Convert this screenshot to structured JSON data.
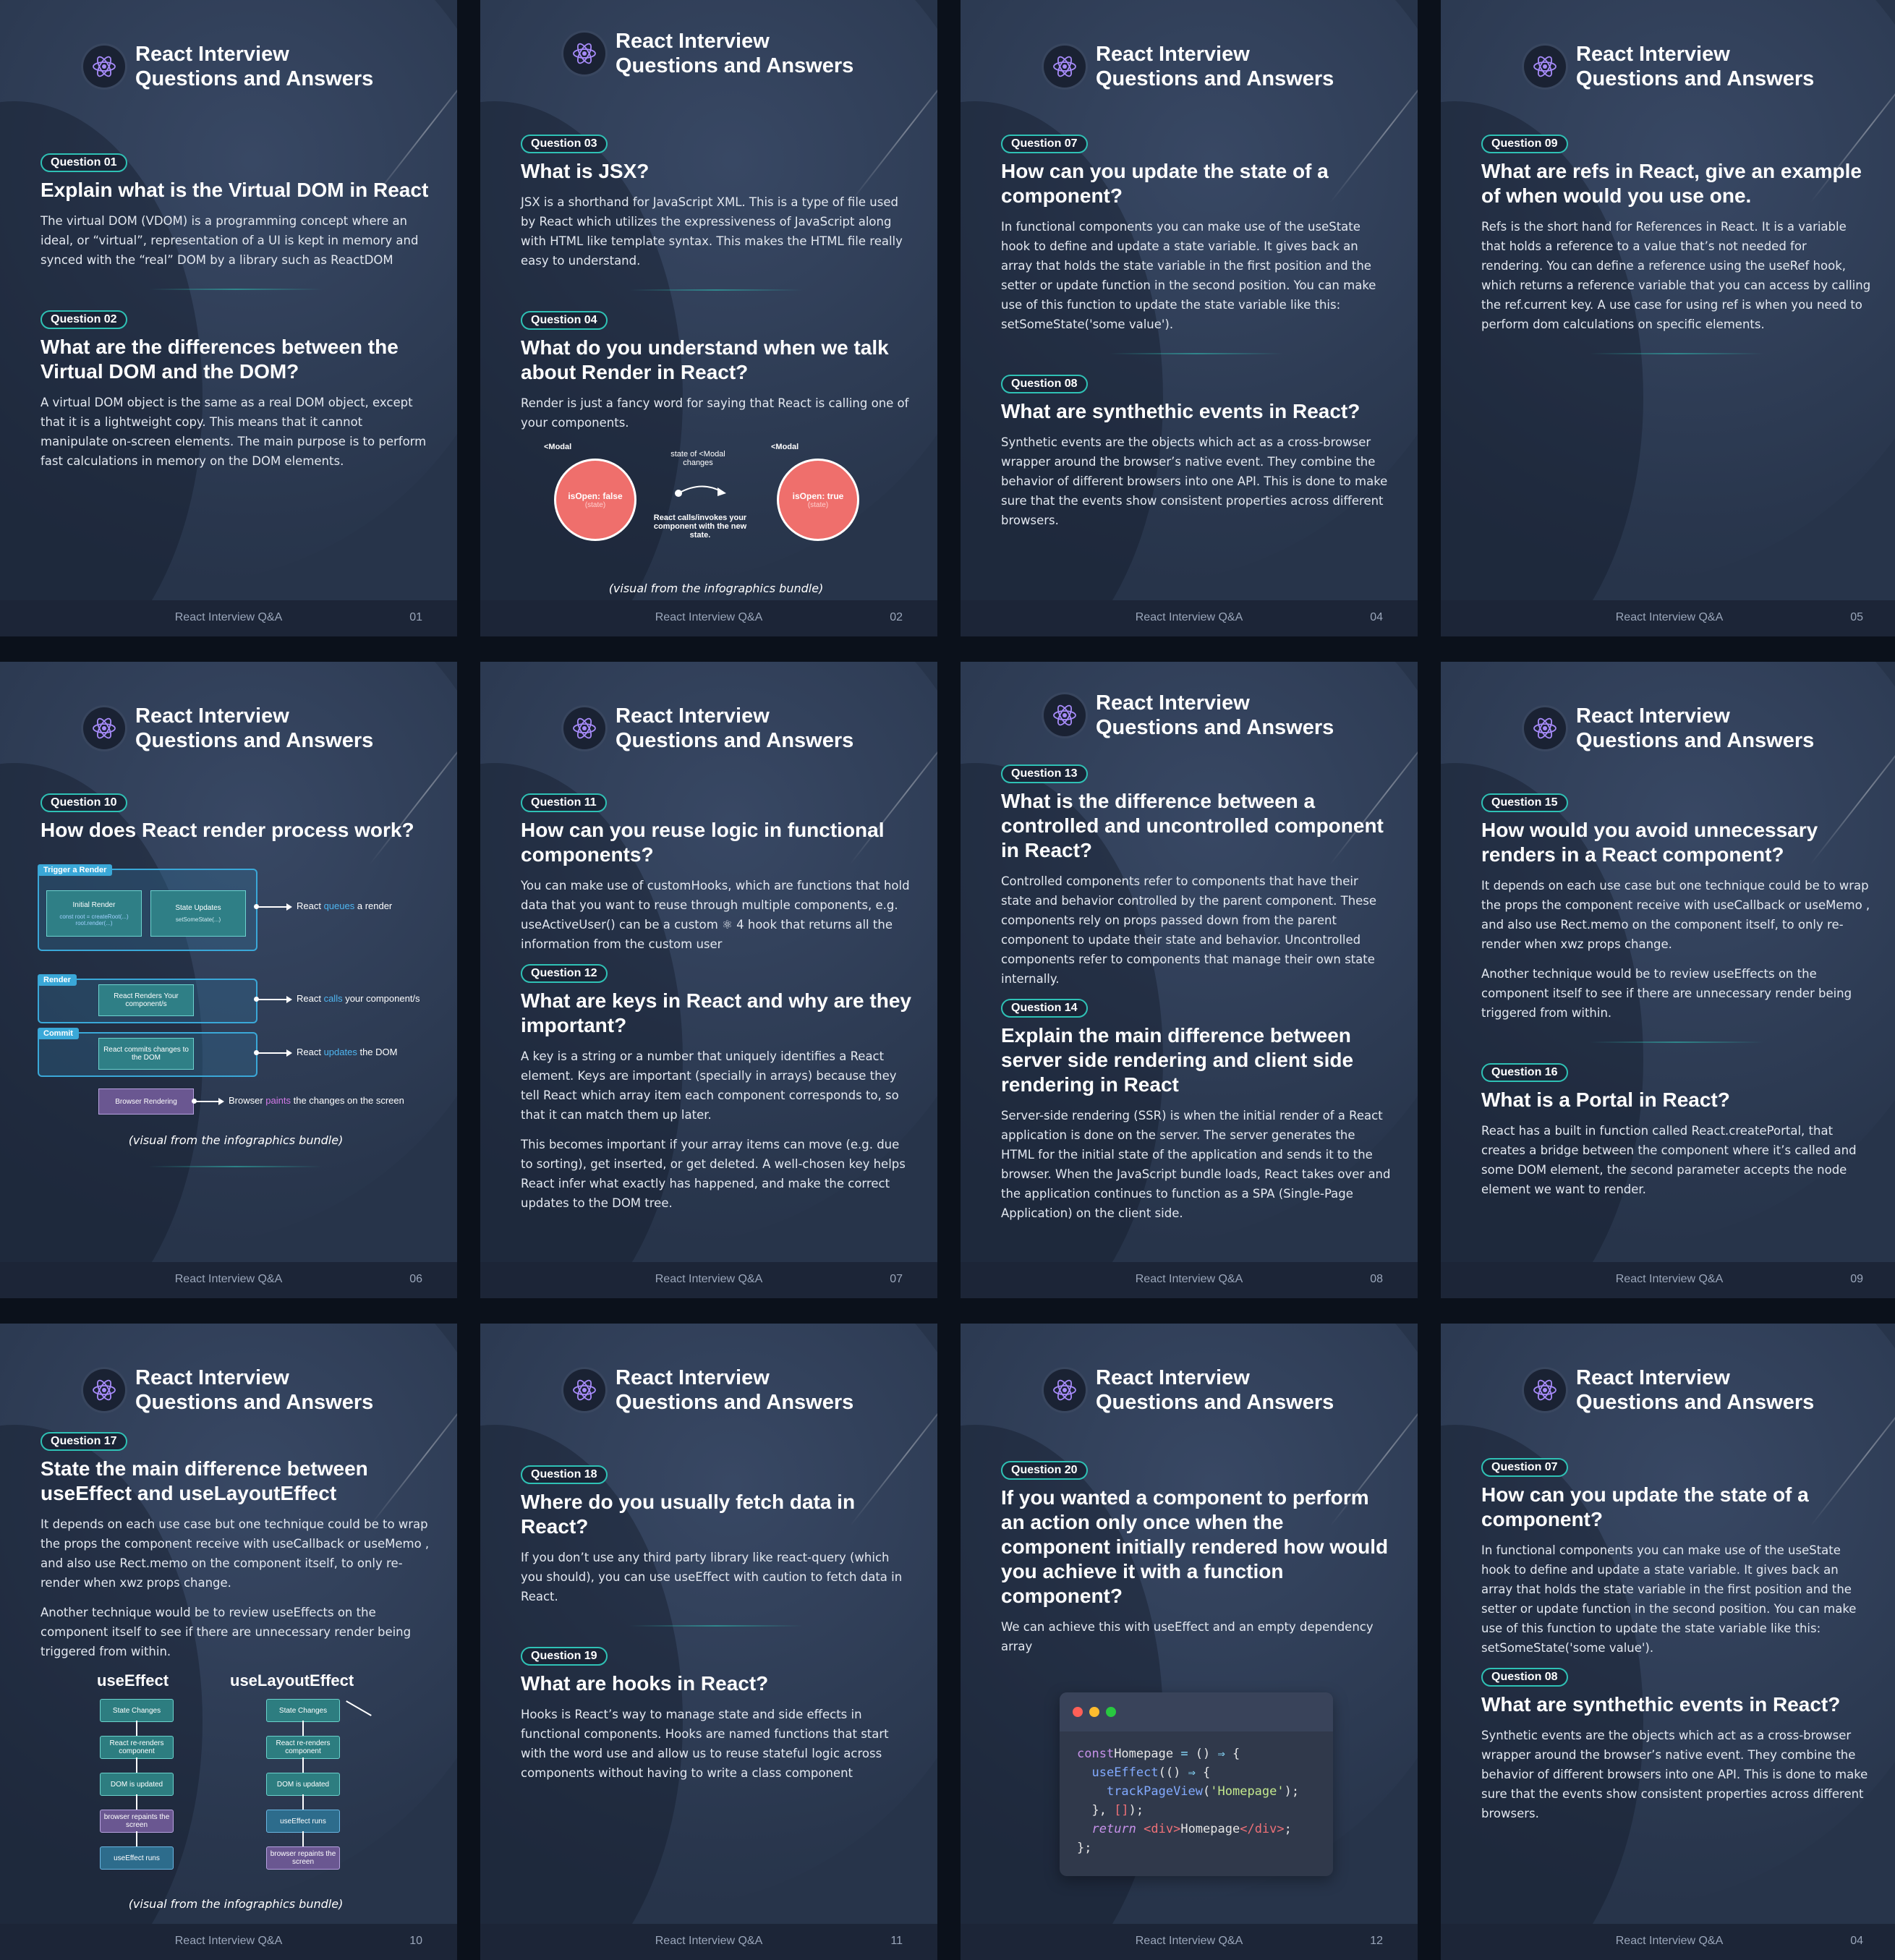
{
  "series_title": [
    "React Interview",
    "Questions and Answers"
  ],
  "footer_label": "React Interview Q&A",
  "caption": "(visual from the infographics bundle)",
  "pages": [
    {
      "number": "01",
      "questions": [
        {
          "badge": "Question 01",
          "title": "Explain what is the Virtual DOM in React",
          "paragraphs": [
            "The virtual DOM (VDOM) is a programming concept where an ideal, or “virtual”, representation of a UI is kept in memory and synced with the “real” DOM by a library such as ReactDOM"
          ]
        },
        {
          "badge": "Question 02",
          "title": "What are the differences between the Virtual DOM and the DOM?",
          "paragraphs": [
            "A virtual DOM object is the same as a real DOM object, except that it is a lightweight copy. This means that it cannot manipulate on-screen elements. The main purpose is to perform fast calculations in memory on the DOM elements."
          ]
        }
      ]
    },
    {
      "number": "02",
      "questions": [
        {
          "badge": "Question 03",
          "title": "What is JSX?",
          "paragraphs": [
            "JSX is a shorthand for JavaScript XML. This is a type of file used by React which utilizes the expressiveness of JavaScript along with HTML like template syntax. This makes the HTML file really easy to understand."
          ]
        },
        {
          "badge": "Question 04",
          "title": "What do you understand when we talk about Render in React?",
          "paragraphs": [
            "Render is just a fancy word for saying that React is calling one of your components."
          ]
        }
      ],
      "render_diagram": {
        "left_tag": "<Modal",
        "right_tag": "<Modal",
        "left_circle": "isOpen: false",
        "right_circle": "isOpen: true",
        "state_sub": "(state)",
        "middle_top": "state of <Modal changes",
        "middle_bottom": "React calls/invokes your component with the new state."
      }
    },
    {
      "number": "04",
      "questions": [
        {
          "badge": "Question 07",
          "title": "How can you update the state of a component?",
          "paragraphs": [
            "In functional components you can make use of the useState hook to define and update a state variable. It gives back an array that holds the state variable in the first position and the setter or update function in the second position. You can make use of this function to update the state variable like this: setSomeState('some value')."
          ]
        },
        {
          "badge": "Question 08",
          "title": "What are synthethic events in React?",
          "paragraphs": [
            "Synthetic events are the objects which act as a cross-browser wrapper around the browser’s native event. They combine the behavior of different browsers into one API. This is done to make sure that the events show consistent properties across different browsers."
          ]
        }
      ]
    },
    {
      "number": "05",
      "questions": [
        {
          "badge": "Question 09",
          "title": "What are refs in React, give an example of when would you use one.",
          "paragraphs": [
            "Refs is the short hand for References in React. It is a variable that holds a reference to a value that’s not needed for rendering. You can define a reference using the useRef hook, which returns a reference variable that you can access by calling the ref.current key. A use case for using ref is when you need to perform dom calculations on specific elements."
          ]
        }
      ]
    },
    {
      "number": "06",
      "questions": [
        {
          "badge": "Question 10",
          "title": "How does React render process work?",
          "paragraphs": []
        }
      ],
      "flow": {
        "trigger": "Trigger a Render",
        "initial": "Initial Render",
        "initial_code": "const root = createRoot(...)\nroot.render(...)",
        "updates": "State Updates",
        "updates_code": "setSomeState(...)",
        "render": "Render",
        "renders_box": "React Renders Your component/s",
        "commit": "Commit",
        "commits_box": "React commits changes to the DOM",
        "browser_box": "Browser Rendering",
        "note1": [
          "React ",
          "queues",
          " a render"
        ],
        "note2": [
          "React ",
          "calls",
          " your component/s"
        ],
        "note3": [
          "React ",
          "updates",
          " the DOM"
        ],
        "note4": [
          "Browser ",
          "paints",
          " the changes on the screen"
        ]
      }
    },
    {
      "number": "07",
      "questions": [
        {
          "badge": "Question 11",
          "title": "How can you reuse logic in functional components?",
          "paragraphs": [
            "You can make use of customHooks, which are functions that hold data that you want to reuse through multiple components, e.g. useActiveUser() can be a custom ⚛ 4 hook that returns all the information from the custom user"
          ]
        },
        {
          "badge": "Question 12",
          "title": "What are keys in React and why are they important?",
          "paragraphs": [
            "A key is a string or a number that uniquely identifies a React element. Keys are important (specially in arrays) because they tell React which array item each component corresponds to, so that it can match them up later.",
            "This becomes important if your array items can move (e.g. due to sorting), get inserted, or get deleted. A well-chosen key helps React infer what exactly has happened, and make the correct updates to the DOM tree."
          ]
        }
      ]
    },
    {
      "number": "08",
      "questions": [
        {
          "badge": "Question 13",
          "title": "What is the difference between a controlled and uncontrolled component in React?",
          "paragraphs": [
            "Controlled components refer to components that have their state and behavior controlled by the parent component. These components rely on props passed down from the parent component to update their state and behavior. Uncontrolled components refer to components that manage their own state internally."
          ]
        },
        {
          "badge": "Question 14",
          "title": "Explain the main difference between server side rendering and client side rendering in React",
          "paragraphs": [
            "Server-side rendering (SSR) is when the initial render of a React application is done on the server. The server generates the HTML for the initial state of the application and sends it to the browser. When the JavaScript bundle loads, React takes over and the application continues to function as a SPA (Single-Page Application) on the client side."
          ]
        }
      ]
    },
    {
      "number": "09",
      "questions": [
        {
          "badge": "Question 15",
          "title": "How would you avoid unnecessary renders in a React component?",
          "paragraphs": [
            "It depends on each use case but one technique could be to wrap the props the component receive with useCallback or useMemo , and also use Rect.memo on the component itself, to only re-render when xwz props change.",
            "Another technique would be to review useEffects on the component itself to see if there are unnecessary render being triggered from within."
          ]
        },
        {
          "badge": "Question 16",
          "title": "What is a Portal in React?",
          "paragraphs": [
            "React has a built in function called React.createPortal, that creates a bridge between the component where it’s called and some DOM element, the second parameter accepts the node element we want to render."
          ]
        }
      ]
    },
    {
      "number": "10",
      "questions": [
        {
          "badge": "Question 17",
          "title": "State the main difference between useEffect and useLayoutEffect",
          "paragraphs": [
            "It depends on each use case but one technique could be to wrap the props the component receive with useCallback or useMemo , and also use Rect.memo on the component itself, to only re-render when xwz props change.",
            "Another technique would be to review useEffects on the component itself to see if there are unnecessary render being triggered from within."
          ]
        }
      ],
      "effects": {
        "left_title": "useEffect",
        "right_title": "useLayoutEffect",
        "left_steps": [
          "State Changes",
          "React re-renders component",
          "DOM is updated",
          "browser repaints the screen",
          "useEffect runs"
        ],
        "right_steps": [
          "State Changes",
          "React re-renders component",
          "DOM is updated",
          "useEffect runs",
          "browser repaints the screen"
        ]
      }
    },
    {
      "number": "11",
      "questions": [
        {
          "badge": "Question 18",
          "title": "Where do you usually fetch data in React?",
          "paragraphs": [
            "If you don’t use any third party library like react-query (which you should), you can use useEffect with caution to fetch data in React."
          ]
        },
        {
          "badge": "Question 19",
          "title": "What are hooks in React?",
          "paragraphs": [
            "Hooks is React’s way to manage state and side effects in functional components. Hooks are named functions that start with the word use and allow us to reuse stateful logic across components without having to write a class component"
          ]
        }
      ]
    },
    {
      "number": "12",
      "questions": [
        {
          "badge": "Question 20",
          "title": "If you wanted a component to perform an action only once when the component initially rendered how would you achieve it with a function component?",
          "paragraphs": [
            "We can achieve this with useEffect and an empty dependency array"
          ]
        }
      ],
      "code": {
        "lines": [
          [
            [
              "kw",
              "const"
            ],
            [
              "",
              "Homepage "
            ],
            [
              "op",
              "="
            ],
            [
              "",
              " () "
            ],
            [
              "op",
              "⇒"
            ],
            [
              "",
              " {"
            ]
          ],
          [
            [
              "",
              "  "
            ],
            [
              "fn",
              "useEffect"
            ],
            [
              "",
              "(() "
            ],
            [
              "op",
              "⇒"
            ],
            [
              "",
              " {"
            ]
          ],
          [
            [
              "",
              "    "
            ],
            [
              "fn",
              "trackPageView"
            ],
            [
              "",
              "("
            ],
            [
              "str",
              "'Homepage'"
            ],
            [
              "",
              ");"
            ]
          ],
          [
            [
              "",
              "  }, "
            ],
            [
              "tag",
              "[]"
            ],
            [
              "",
              ");"
            ]
          ],
          [
            [
              "",
              "  "
            ],
            [
              "it",
              "return"
            ],
            [
              "",
              ""
            ],
            [
              "tag",
              " <div>"
            ],
            [
              "",
              "Homepage"
            ],
            [
              "tag",
              "</div>"
            ],
            [
              "",
              ";"
            ]
          ],
          [
            [
              "",
              "};"
            ]
          ]
        ]
      }
    },
    {
      "number": "04",
      "questions": [
        {
          "badge": "Question 07",
          "title": "How can you update the state of a component?",
          "paragraphs": [
            "In functional components you can make use of the useState hook to define and update a state variable. It gives back an array that holds the state variable in the first position and the setter or update function in the second position. You can make use of this function to update the state variable like this: setSomeState('some value')."
          ]
        },
        {
          "badge": "Question 08",
          "title": "What are synthethic events in React?",
          "paragraphs": [
            "Synthetic events are the objects which act as a cross-browser wrapper around the browser’s native event. They combine the behavior of different browsers into one API. This is done to make sure that the events show consistent properties across different browsers."
          ]
        }
      ]
    }
  ],
  "colors": {
    "page_bg": "#27344a",
    "accent": "#2fc1b5",
    "logo_purple": "#a78bfa"
  }
}
